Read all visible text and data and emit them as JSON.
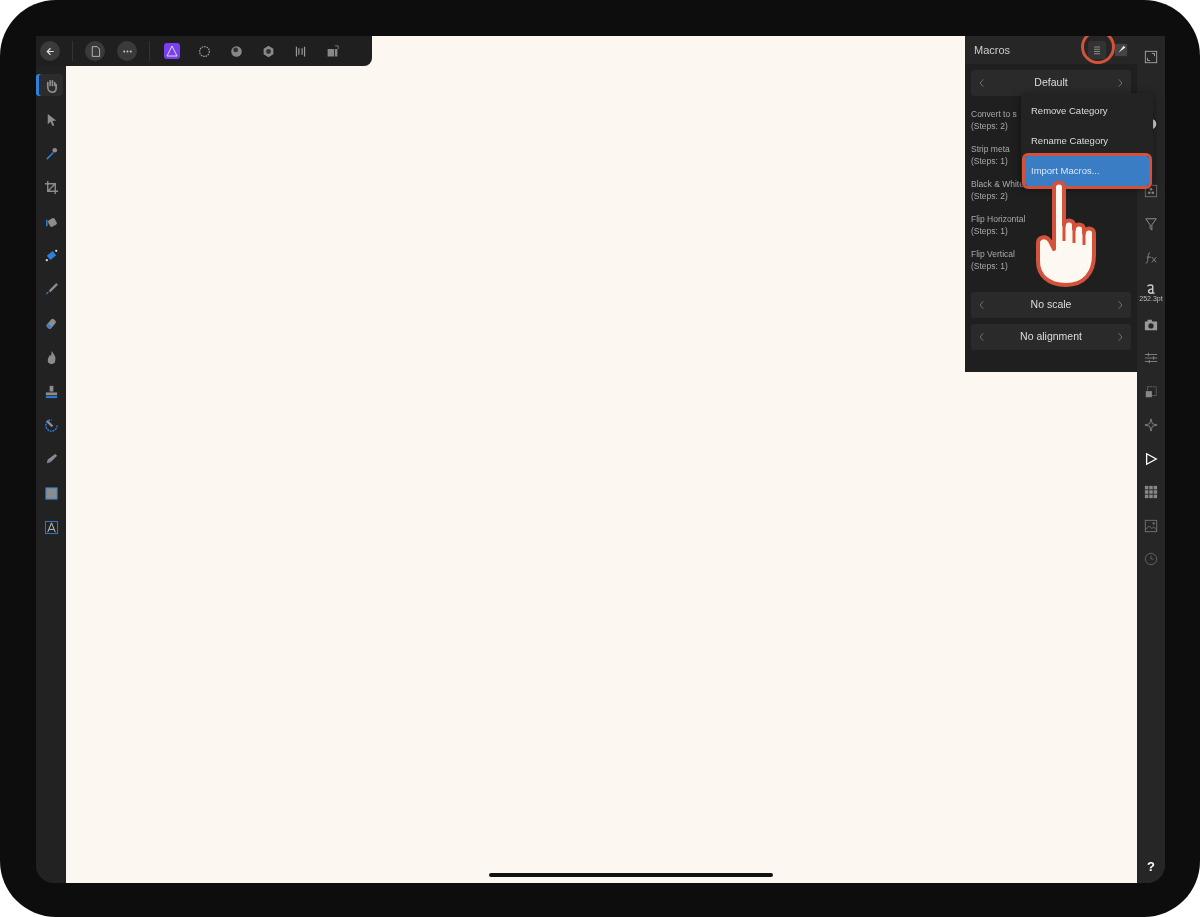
{
  "top_toolbar": {
    "groups": [
      [
        {
          "kind": "back"
        }
      ],
      [
        {
          "kind": "document"
        },
        {
          "kind": "more"
        }
      ],
      [
        {
          "kind": "photo"
        },
        {
          "kind": "liquify"
        },
        {
          "kind": "develop"
        },
        {
          "kind": "tone"
        },
        {
          "kind": "export"
        },
        {
          "kind": "layout"
        }
      ]
    ]
  },
  "tools": [
    {
      "kind": "hand",
      "selected": true
    },
    {
      "kind": "pointer",
      "selected": false
    },
    {
      "kind": "picker",
      "selected": false
    },
    {
      "kind": "crop",
      "selected": false
    },
    {
      "kind": "fill",
      "selected": false
    },
    {
      "kind": "gradient",
      "selected": false
    },
    {
      "kind": "brush",
      "selected": false
    },
    {
      "kind": "eraser",
      "selected": false
    },
    {
      "kind": "burn",
      "selected": false
    },
    {
      "kind": "stamp",
      "selected": false
    },
    {
      "kind": "redeye",
      "selected": false
    },
    {
      "kind": "pen",
      "selected": false
    },
    {
      "kind": "rect",
      "selected": false
    },
    {
      "kind": "text",
      "selected": false
    }
  ],
  "studio_strip": [
    {
      "kind": "expand"
    },
    {
      "kind": "hidden"
    },
    {
      "kind": "circle"
    },
    {
      "kind": "hidden"
    },
    {
      "kind": "dots"
    },
    {
      "kind": "filter"
    },
    {
      "kind": "fx"
    },
    {
      "kind": "type",
      "label": "252.3pt"
    },
    {
      "kind": "camera"
    },
    {
      "kind": "sliders"
    },
    {
      "kind": "transform"
    },
    {
      "kind": "navigator"
    },
    {
      "kind": "play"
    },
    {
      "kind": "grid"
    },
    {
      "kind": "image"
    },
    {
      "kind": "clock"
    }
  ],
  "macros_panel": {
    "title": "Macros",
    "category": "Default",
    "macros": [
      {
        "name": "Convert to s",
        "steps": "(Steps: 2)"
      },
      {
        "name": "Strip meta",
        "steps": "(Steps: 1)"
      },
      {
        "name": "Black & White",
        "steps": "(Steps: 2)"
      },
      {
        "name": "Flip Horizontal",
        "steps": "(Steps: 1)"
      },
      {
        "name": "Flip Vertical",
        "steps": "(Steps: 1)"
      }
    ],
    "selectors": [
      "No scale",
      "No alignment"
    ]
  },
  "menu": {
    "items": [
      {
        "label": "Remove Category",
        "selected": false
      },
      {
        "label": "Rename Category",
        "selected": false
      },
      {
        "label": "Import Macros...",
        "selected": true
      }
    ]
  },
  "help": "?"
}
